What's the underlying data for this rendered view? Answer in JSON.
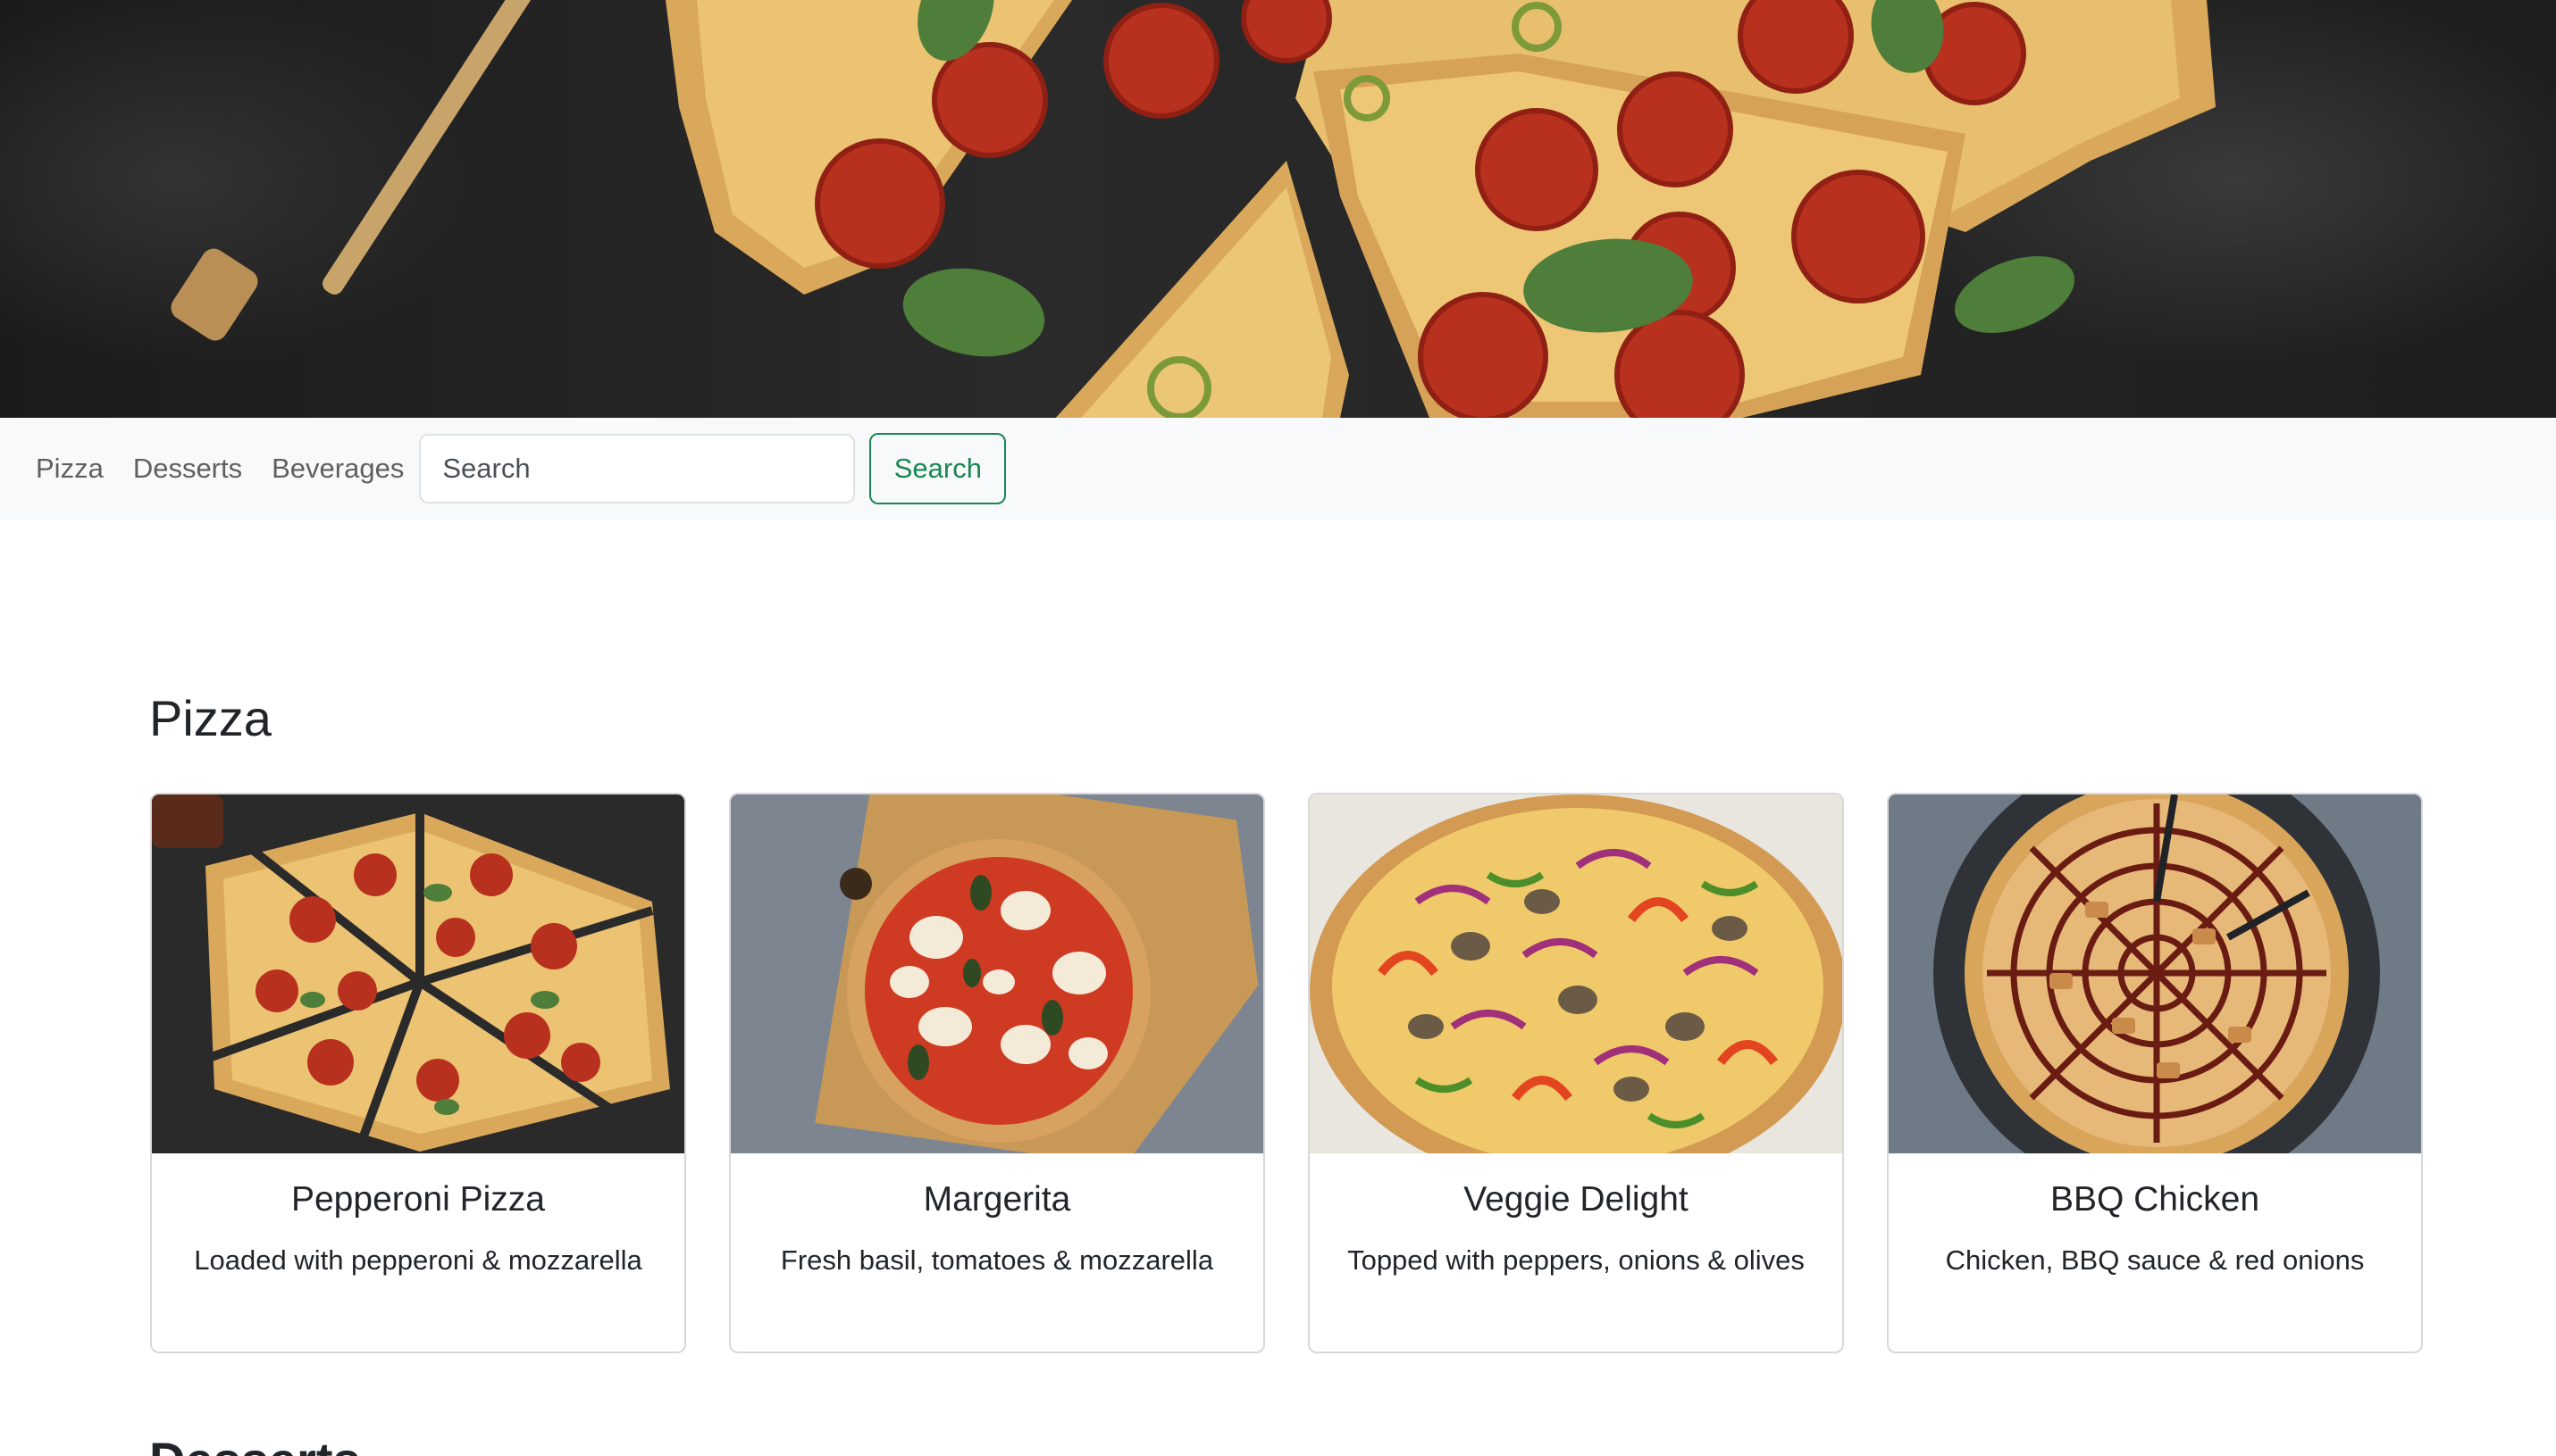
{
  "nav": {
    "items": [
      "Pizza",
      "Desserts",
      "Beverages"
    ],
    "search_placeholder": "Search",
    "search_button": "Search"
  },
  "section": {
    "title": "Pizza"
  },
  "cards": [
    {
      "title": "Pepperoni Pizza",
      "text": "Loaded with pepperoni & mozzarella"
    },
    {
      "title": "Margerita",
      "text": "Fresh basil, tomatoes & mozzarella"
    },
    {
      "title": "Veggie Delight",
      "text": "Topped with peppers, onions & olives"
    },
    {
      "title": "BBQ Chicken",
      "text": "Chicken, BBQ sauce & red onions"
    }
  ],
  "next_section": {
    "title": "Desserts"
  },
  "colors": {
    "accent": "#198754",
    "navbar_bg": "#f8f9fa",
    "card_border": "#d8d8d8"
  }
}
